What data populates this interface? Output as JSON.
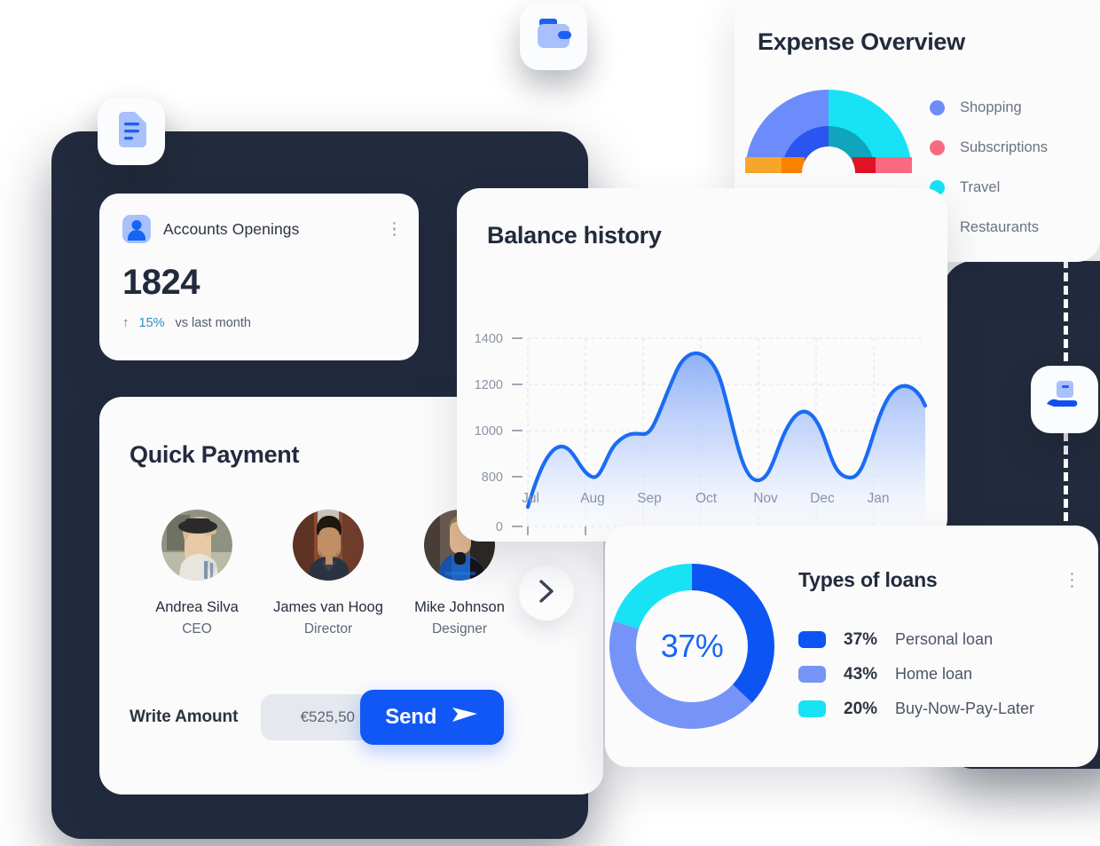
{
  "accounts_card": {
    "icon": "person-icon",
    "title": "Accounts Openings",
    "menu_icon": "kebab-menu-icon",
    "value": "1824",
    "trend_icon": "arrow-up-icon",
    "trend_percent": "15%",
    "trend_caption": "vs last month",
    "trend_color": "#2f8ec4"
  },
  "quick_payment": {
    "title": "Quick Payment",
    "next_icon": "chevron-right-icon",
    "people": [
      {
        "name": "Andrea Silva",
        "role": "CEO",
        "avatar": "avatar-woman-hat"
      },
      {
        "name": "James van Hoog",
        "role": "Director",
        "avatar": "avatar-man-beard"
      },
      {
        "name": "Mike Johnson",
        "role": "Designer",
        "avatar": "avatar-man-bluejacket"
      }
    ],
    "amount_label": "Write Amount",
    "amount_value": "€525,50",
    "send_label": "Send",
    "send_icon": "paper-plane-icon",
    "send_color": "#1157f5"
  },
  "balance_history": {
    "title": "Balance history"
  },
  "expense_overview": {
    "title": "Expense Overview",
    "legend": [
      {
        "label": "Shopping",
        "color": "#6b8cfa"
      },
      {
        "label": "Subscriptions",
        "color": "#f9697f"
      },
      {
        "label": "Travel",
        "color": "#18e3f5"
      },
      {
        "label": "Restaurants",
        "color": "#f6a62b"
      }
    ]
  },
  "types_of_loans": {
    "title": "Types of loans",
    "menu_icon": "kebab-menu-icon",
    "center_value": "37%",
    "legend": [
      {
        "percent": "37%",
        "name": "Personal loan",
        "color": "#0c55f2"
      },
      {
        "percent": "43%",
        "name": "Home loan",
        "color": "#7694f7"
      },
      {
        "percent": "20%",
        "name": "Buy-Now-Pay-Later",
        "color": "#18e3f5"
      }
    ]
  },
  "floating_icons": [
    {
      "name": "document-icon"
    },
    {
      "name": "wallet-icon"
    },
    {
      "name": "hand-holding-card-icon"
    }
  ],
  "chart_data": [
    {
      "type": "area",
      "title": "Balance history",
      "xlabel": "",
      "ylabel": "",
      "x": [
        "Jul",
        "Aug",
        "Sep",
        "Oct",
        "Nov",
        "Dec",
        "Jan"
      ],
      "ytick_labels": [
        "0",
        "800",
        "1000",
        "1200",
        "1400"
      ],
      "ytick_values": [
        0,
        800,
        1000,
        1200,
        1400
      ],
      "ylim": [
        0,
        1400
      ],
      "grid": true,
      "legend": "none",
      "line_color": "#1a6cf2",
      "fill_gradient": [
        "#9cb9f7",
        "#f4f8ff"
      ],
      "points": [
        {
          "x": "Jul",
          "y": 700
        },
        {
          "x": "Jul+",
          "y": 910
        },
        {
          "x": "Aug",
          "y": 820
        },
        {
          "x": "Aug+",
          "y": 1050
        },
        {
          "x": "Sep",
          "y": 1000
        },
        {
          "x": "Sep+",
          "y": 1340
        },
        {
          "x": "Nov",
          "y": 780
        },
        {
          "x": "Nov+",
          "y": 1140
        },
        {
          "x": "Dec+",
          "y": 810
        },
        {
          "x": "Jan",
          "y": 1205
        },
        {
          "x": "Jan+",
          "y": 1160
        }
      ]
    },
    {
      "type": "pie",
      "title": "Expense Overview",
      "subtitle": "semi-donut, two concentric rings",
      "labels": [
        "Shopping",
        "Subscriptions",
        "Travel",
        "Restaurants"
      ],
      "outer_ring_colors": [
        "#6b8cfa",
        "#f9697f",
        "#18e3f5",
        "#f6a62b"
      ],
      "inner_ring_colors": [
        "#2b55f0",
        "#e01326",
        "#0fa5bd",
        "#fb8100"
      ],
      "outer_values": [
        38,
        8,
        46,
        8
      ],
      "inner_values": [
        38,
        8,
        46,
        8
      ],
      "legend": "right"
    },
    {
      "type": "pie",
      "title": "Types of loans",
      "labels": [
        "Personal loan",
        "Home loan",
        "Buy-Now-Pay-Later"
      ],
      "values": [
        37,
        43,
        20
      ],
      "colors": [
        "#0c55f2",
        "#7694f7",
        "#18e3f5"
      ],
      "center_label": "37%",
      "legend": "right"
    }
  ]
}
